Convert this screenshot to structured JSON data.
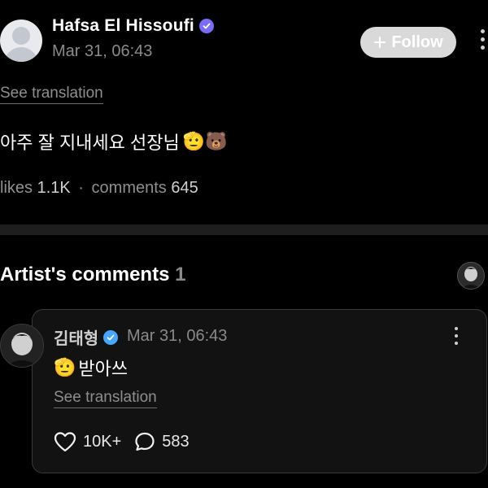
{
  "post": {
    "author": "Hafsa El Hissoufi",
    "timestamp": "Mar 31, 06:43",
    "follow_label": "Follow",
    "see_translation": "See translation",
    "text": "아주 잘 지내세요 선장님",
    "emoji": "🫡🐻",
    "likes_label": "likes",
    "likes_value": "1.1K",
    "comments_label": "comments",
    "comments_value": "645",
    "separator": "·",
    "badge_color": "#7b6cf6"
  },
  "artist_comments": {
    "title": "Artist's comments",
    "count": "1"
  },
  "comment": {
    "author": "김태형",
    "timestamp": "Mar 31, 06:43",
    "emoji": "🫡",
    "text": "받아쓰",
    "see_translation": "See translation",
    "likes": "10K+",
    "replies": "583",
    "badge_color": "#47a7ff"
  },
  "icons": [
    "more-vertical-icon",
    "verified-badge-icon",
    "plus-icon",
    "heart-icon",
    "comment-bubble-icon"
  ]
}
